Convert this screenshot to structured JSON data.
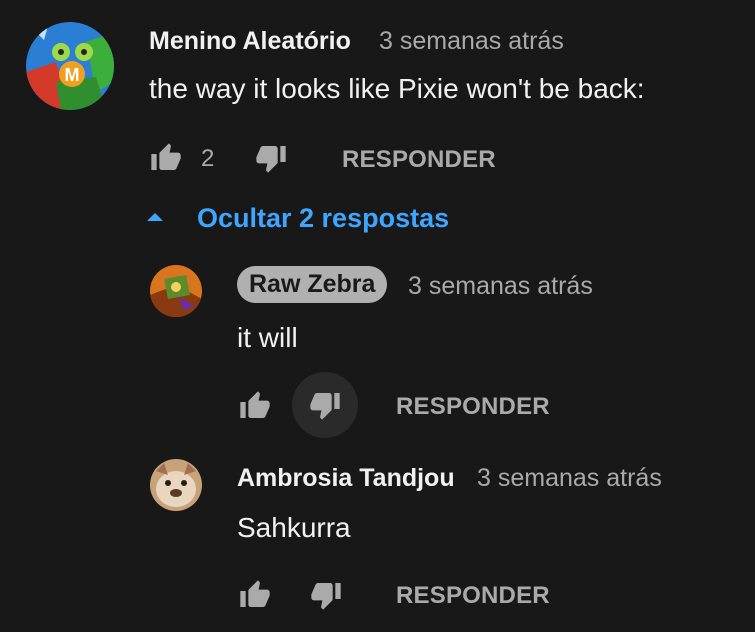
{
  "comment": {
    "author": "Menino Aleatório",
    "time": "3 semanas atrás",
    "text": "the way it looks like Pixie won't be back:",
    "like_count": "2",
    "reply_label": "RESPONDER",
    "avatar_icon": "avatar-image",
    "avatar_letter": "M"
  },
  "replies_toggle": {
    "label": "Ocultar 2 respostas",
    "icon": "caret-up-icon",
    "color": "#3ea6ff"
  },
  "replies": [
    {
      "author": "Raw Zebra",
      "time": "3 semanas atrás",
      "text": "it will",
      "reply_label": "RESPONDER"
    },
    {
      "author": "Ambrosia Tandjou",
      "time": "3 semanas atrás",
      "text": "Sahkurra",
      "reply_label": "RESPONDER"
    }
  ],
  "colors": {
    "background": "#181818",
    "text": "#f1f1f1",
    "secondary": "#aaaaaa",
    "link": "#3ea6ff"
  }
}
